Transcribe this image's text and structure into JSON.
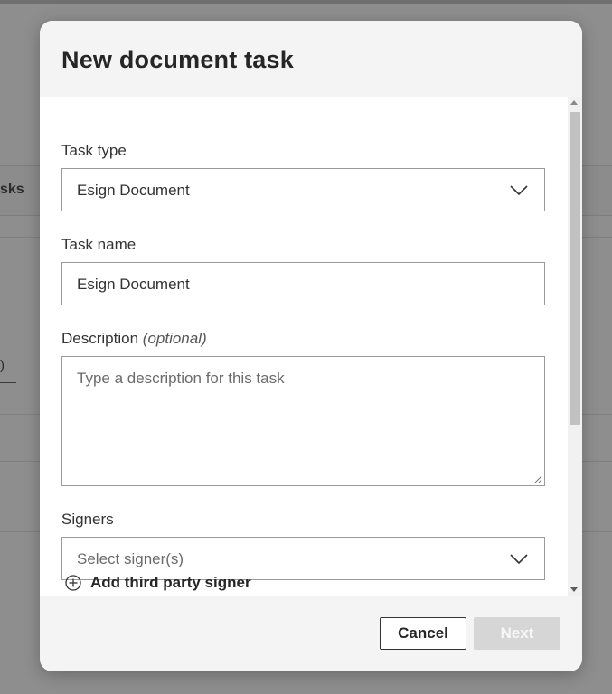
{
  "background": {
    "tab_fragment": "sks",
    "input_fragment": ")"
  },
  "modal": {
    "title": "New document task",
    "fields": {
      "task_type": {
        "label": "Task type",
        "value": "Esign Document",
        "icon": "chevron-down-icon"
      },
      "task_name": {
        "label": "Task name",
        "value": "Esign Document"
      },
      "description": {
        "label": "Description",
        "optional": "(optional)",
        "placeholder": "Type a description for this task"
      },
      "signers": {
        "label": "Signers",
        "placeholder": "Select signer(s)",
        "icon": "chevron-down-icon"
      }
    },
    "add_third_party": {
      "label": "Add third party signer",
      "icon": "plus-circle-icon"
    },
    "footer": {
      "cancel_label": "Cancel",
      "next_label": "Next"
    }
  },
  "colors": {
    "overlay": "#8e8e8e",
    "modal_header_bg": "#f4f4f4",
    "border": "#9b9b9b",
    "next_disabled_bg": "#d6d6d6",
    "text": "#262626"
  }
}
